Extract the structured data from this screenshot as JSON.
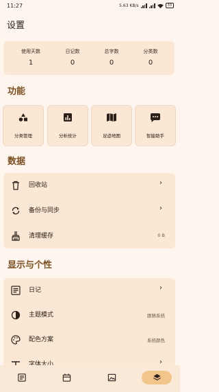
{
  "status": {
    "time": "11:27",
    "speed": "5.63 KB/s",
    "battery": "33"
  },
  "page": {
    "title": "设置"
  },
  "stats": [
    {
      "label": "使用天数",
      "value": "1"
    },
    {
      "label": "日记数",
      "value": "0"
    },
    {
      "label": "总字数",
      "value": "0"
    },
    {
      "label": "分类数",
      "value": "0"
    }
  ],
  "features": {
    "heading": "功能",
    "tiles": [
      {
        "label": "分类管理",
        "icon": "category-icon"
      },
      {
        "label": "分析统计",
        "icon": "analytics-icon"
      },
      {
        "label": "足迹地图",
        "icon": "map-icon"
      },
      {
        "label": "智能助手",
        "icon": "chat-icon"
      }
    ]
  },
  "data_section": {
    "heading": "数据",
    "items": [
      {
        "label": "回收站",
        "icon": "trash-icon",
        "value": ""
      },
      {
        "label": "备份与同步",
        "icon": "sync-icon",
        "value": ""
      },
      {
        "label": "清理缓存",
        "icon": "broom-icon",
        "value": "0 B"
      }
    ]
  },
  "display_section": {
    "heading": "显示与个性",
    "items": [
      {
        "label": "日记",
        "icon": "article-icon",
        "value": ""
      },
      {
        "label": "主题模式",
        "icon": "contrast-icon",
        "value": "跟随系统"
      },
      {
        "label": "配色方案",
        "icon": "palette-icon",
        "value": "系统颜色"
      },
      {
        "label": "字体大小",
        "icon": "font-size-icon",
        "value": ""
      }
    ]
  },
  "nav": {
    "items": [
      "diary",
      "calendar",
      "gallery",
      "settings"
    ],
    "active": "settings"
  },
  "colors": {
    "background": "#fef6ee",
    "card": "#fbe7d3",
    "heading": "#7a4f22",
    "nav_active": "#f2c58c"
  }
}
